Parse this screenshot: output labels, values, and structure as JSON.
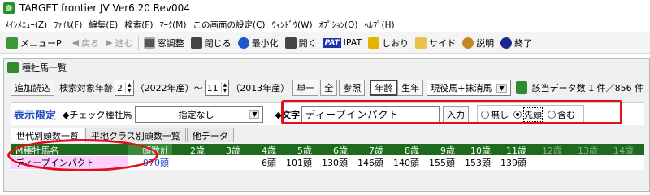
{
  "window": {
    "title": "TARGET frontier JV   Ver6.20   Rev004"
  },
  "menubar": [
    "ﾒｲﾝﾒﾆｭｰ(Z)",
    "ﾌｧｲﾙ(F)",
    "編集(E)",
    "検索(F)",
    "ﾏｰｸ(M)",
    "この画面の設定(C)",
    "ｳｨﾝﾄﾞｳ(W)",
    "ｵﾌﾟｼｮﾝ(O)",
    "ﾍﾙﾌﾟ(H)"
  ],
  "toolbar": {
    "menu": "メニューP",
    "back": "戻る",
    "forward": "進む",
    "window_adjust": "窓調整",
    "close": "閉じる",
    "minimize": "最小化",
    "open": "開く",
    "ipat_badge": "PAT",
    "ipat": "IPAT",
    "bookmark": "しおり",
    "side": "サイド",
    "help": "説明",
    "exit": "終了"
  },
  "subwindow": {
    "title": "種牡馬一覧",
    "controls": {
      "add_read": "追加読込",
      "age_label": "検索対象年齢",
      "age_from": "2",
      "year_from": "（2022年産）～",
      "age_to": "11",
      "year_to": "（2013年産）",
      "single": "単一",
      "all": "全",
      "reference": "参照",
      "age_toggle": "年齢",
      "birth_year_toggle": "生年",
      "horse_filter": "現役馬+抹消馬",
      "count": "該当データ数 1 件／856 件"
    },
    "filter": {
      "label": "表示限定",
      "check_sire_label": "◆チェック種牡馬",
      "check_sire_value": "指定なし",
      "text_label": "◆文字",
      "text_value": "ディープインパクト",
      "input_button": "入力",
      "radio_none": "無し",
      "radio_prefix": "先頭",
      "radio_contains": "含む"
    },
    "tabs": [
      "世代別頭数一覧",
      "平地クラス別頭数一覧",
      "他データ"
    ],
    "table": {
      "headers": [
        "M種牡馬名",
        "頭数計",
        "2歳",
        "3歳",
        "4歳",
        "5歳",
        "6歳",
        "7歳",
        "8歳",
        "9歳",
        "10歳",
        "11歳",
        "12歳",
        "13歳",
        "14歳"
      ],
      "rows": [
        [
          "ディープインパクト",
          "970頭",
          "",
          "",
          "6頭",
          "101頭",
          "130頭",
          "146頭",
          "140頭",
          "155頭",
          "153頭",
          "139頭",
          "",
          "",
          ""
        ]
      ]
    }
  }
}
